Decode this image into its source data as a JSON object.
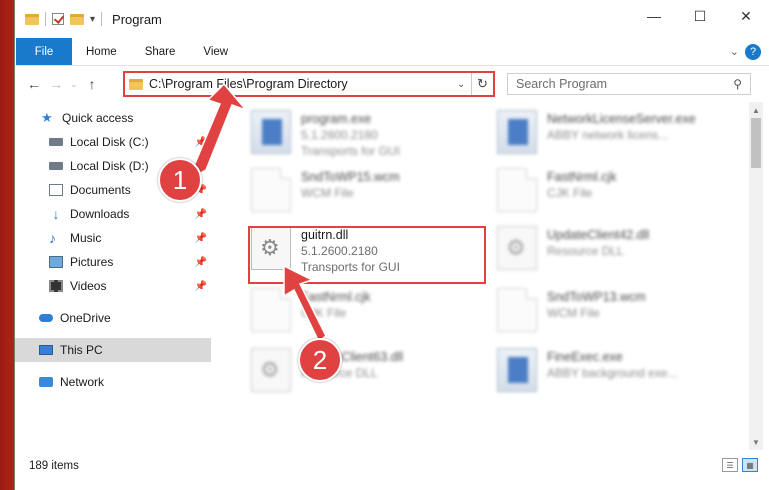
{
  "window": {
    "title": "Program",
    "controls": {
      "minimize": "—",
      "maximize": "☐",
      "close": "✕"
    }
  },
  "ribbon": {
    "tabs": [
      "File",
      "Home",
      "Share",
      "View"
    ]
  },
  "address": {
    "path": "C:\\Program Files\\Program Directory"
  },
  "search": {
    "placeholder": "Search Program"
  },
  "sidebar": {
    "items": [
      {
        "label": "Quick access",
        "icon": "star-icon",
        "pinned": false
      },
      {
        "label": "Local Disk (C:)",
        "icon": "drive-icon",
        "pinned": true
      },
      {
        "label": "Local Disk (D:)",
        "icon": "drive-icon",
        "pinned": true
      },
      {
        "label": "Documents",
        "icon": "documents-icon",
        "pinned": true
      },
      {
        "label": "Downloads",
        "icon": "download-icon",
        "pinned": true
      },
      {
        "label": "Music",
        "icon": "music-icon",
        "pinned": true
      },
      {
        "label": "Pictures",
        "icon": "pictures-icon",
        "pinned": true
      },
      {
        "label": "Videos",
        "icon": "videos-icon",
        "pinned": true
      },
      {
        "label": "OneDrive",
        "icon": "onedrive-icon",
        "pinned": false
      },
      {
        "label": "This PC",
        "icon": "this-pc-icon",
        "pinned": false,
        "selected": true
      },
      {
        "label": "Network",
        "icon": "network-icon",
        "pinned": false
      }
    ]
  },
  "files": [
    {
      "name": "program.exe",
      "line1": "5.1.2600.2180",
      "line2": "Transports for GUI"
    },
    {
      "name": "NetworkLicenseServer.exe",
      "line1": "ABBY network licens...",
      "line2": ""
    },
    {
      "name": "SndToWP15.wcm",
      "line1": "WCM File",
      "line2": ""
    },
    {
      "name": "FastNrml.cjk",
      "line1": "CJK File",
      "line2": ""
    },
    {
      "name": "guitrn.dll",
      "line1": "5.1.2600.2180",
      "line2": "Transports for GUI"
    },
    {
      "name": "UpdateClient42.dll",
      "line1": "Resource DLL",
      "line2": ""
    },
    {
      "name": "FastNrml.cjk",
      "line1": "CJK File",
      "line2": ""
    },
    {
      "name": "SndToWP13.wcm",
      "line1": "WCM File",
      "line2": ""
    },
    {
      "name": "UpdateClient63.dll",
      "line1": "Resource DLL",
      "line2": ""
    },
    {
      "name": "FineExec.exe",
      "line1": "ABBY background exe...",
      "line2": ""
    }
  ],
  "status": {
    "count": "189 items"
  },
  "annotations": {
    "step1": "1",
    "step2": "2",
    "color": "#e04141"
  }
}
